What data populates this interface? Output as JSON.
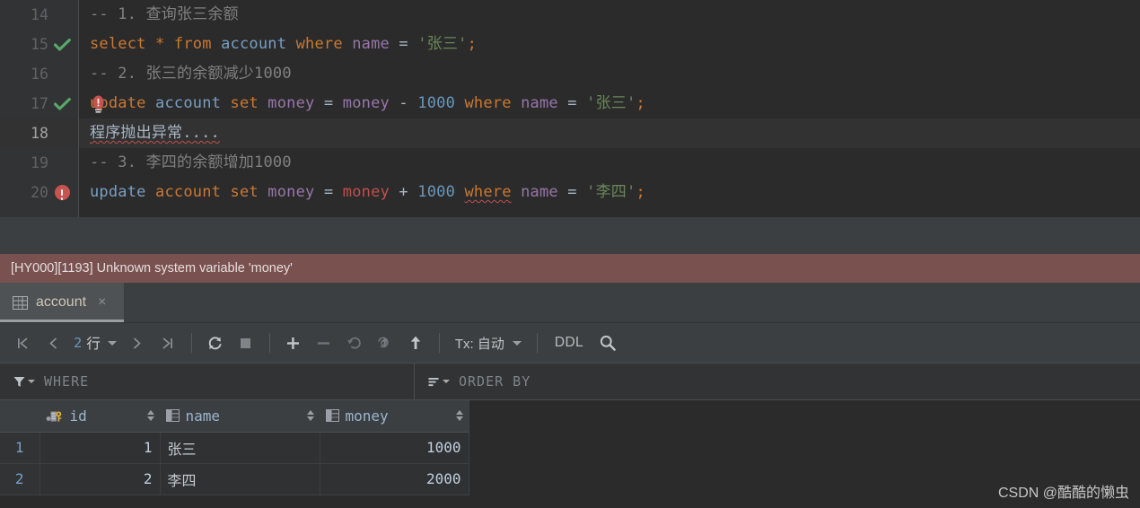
{
  "editor": {
    "lines": [
      {
        "number": "14",
        "marker": "none",
        "current": false,
        "tokens": [
          {
            "text": "-- 1. 查询张三余额",
            "cls": "cmt"
          }
        ]
      },
      {
        "number": "15",
        "marker": "check",
        "current": false,
        "tokens": [
          {
            "text": "select",
            "cls": "kw"
          },
          {
            "text": " ",
            "cls": "op"
          },
          {
            "text": "*",
            "cls": "kw"
          },
          {
            "text": " ",
            "cls": "op"
          },
          {
            "text": "from",
            "cls": "kw"
          },
          {
            "text": " ",
            "cls": "op"
          },
          {
            "text": "account",
            "cls": "tbl"
          },
          {
            "text": " ",
            "cls": "op"
          },
          {
            "text": "where",
            "cls": "kw"
          },
          {
            "text": " ",
            "cls": "op"
          },
          {
            "text": "name",
            "cls": "col"
          },
          {
            "text": " ",
            "cls": "op"
          },
          {
            "text": "=",
            "cls": "op"
          },
          {
            "text": " ",
            "cls": "op"
          },
          {
            "text": "'张三'",
            "cls": "str"
          },
          {
            "text": ";",
            "cls": "punct"
          }
        ]
      },
      {
        "number": "16",
        "marker": "none",
        "current": false,
        "tokens": [
          {
            "text": "-- 2. 张三的余额减少1000",
            "cls": "cmt"
          }
        ]
      },
      {
        "number": "17",
        "marker": "check",
        "current": false,
        "tokens": [
          {
            "text": "update",
            "cls": "kw"
          },
          {
            "text": " ",
            "cls": "op"
          },
          {
            "text": "account",
            "cls": "tbl"
          },
          {
            "text": " ",
            "cls": "op"
          },
          {
            "text": "set",
            "cls": "kw"
          },
          {
            "text": " ",
            "cls": "op"
          },
          {
            "text": "money",
            "cls": "col"
          },
          {
            "text": " ",
            "cls": "op"
          },
          {
            "text": "=",
            "cls": "op"
          },
          {
            "text": " ",
            "cls": "op"
          },
          {
            "text": "money",
            "cls": "col"
          },
          {
            "text": " ",
            "cls": "op"
          },
          {
            "text": "-",
            "cls": "op"
          },
          {
            "text": " ",
            "cls": "op"
          },
          {
            "text": "1000",
            "cls": "num"
          },
          {
            "text": " ",
            "cls": "op"
          },
          {
            "text": "where",
            "cls": "kw"
          },
          {
            "text": " ",
            "cls": "op"
          },
          {
            "text": "name",
            "cls": "col"
          },
          {
            "text": " ",
            "cls": "op"
          },
          {
            "text": "=",
            "cls": "op"
          },
          {
            "text": " ",
            "cls": "op"
          },
          {
            "text": "'张三'",
            "cls": "str"
          },
          {
            "text": ";",
            "cls": "punct"
          }
        ]
      },
      {
        "number": "18",
        "marker": "none",
        "current": true,
        "tokens": [
          {
            "text": "程序抛出异常....",
            "cls": "plaintxt squig"
          }
        ]
      },
      {
        "number": "19",
        "marker": "none",
        "current": false,
        "tokens": [
          {
            "text": "-- 3. 李四的余额增加1000",
            "cls": "cmt"
          }
        ]
      },
      {
        "number": "20",
        "marker": "error",
        "current": false,
        "tokens": [
          {
            "text": "update",
            "cls": "tbl"
          },
          {
            "text": " ",
            "cls": "op"
          },
          {
            "text": "account",
            "cls": "kw"
          },
          {
            "text": " ",
            "cls": "op"
          },
          {
            "text": "set",
            "cls": "kw"
          },
          {
            "text": " ",
            "cls": "op"
          },
          {
            "text": "money",
            "cls": "col"
          },
          {
            "text": " ",
            "cls": "op"
          },
          {
            "text": "=",
            "cls": "op"
          },
          {
            "text": " ",
            "cls": "op"
          },
          {
            "text": "money",
            "cls": "bad"
          },
          {
            "text": " ",
            "cls": "op"
          },
          {
            "text": "+",
            "cls": "op"
          },
          {
            "text": " ",
            "cls": "op"
          },
          {
            "text": "1000",
            "cls": "num"
          },
          {
            "text": " ",
            "cls": "op"
          },
          {
            "text": "where",
            "cls": "kw squig"
          },
          {
            "text": " ",
            "cls": "op"
          },
          {
            "text": "name",
            "cls": "col"
          },
          {
            "text": " ",
            "cls": "op"
          },
          {
            "text": "=",
            "cls": "op"
          },
          {
            "text": " ",
            "cls": "op"
          },
          {
            "text": "'李四'",
            "cls": "str"
          },
          {
            "text": ";",
            "cls": "punct"
          }
        ]
      }
    ],
    "intention_icon": "lightbulb-error-icon"
  },
  "error_bar": {
    "message": "[HY000][1193] Unknown system variable 'money'",
    "background_color": "#79514f"
  },
  "result_tab": {
    "icon": "table-grid-icon",
    "label": "account",
    "close_label": "×"
  },
  "toolbar": {
    "first_page_icon": "|<",
    "prev_page_icon": "‹",
    "rows_count": "2",
    "rows_unit": "行",
    "next_page_icon": "›",
    "last_page_icon": ">|",
    "reload_icon": "refresh-icon",
    "stop_icon": "stop-icon",
    "add_row_icon": "+",
    "remove_row_icon": "−",
    "revert_icon": "↶",
    "revert_selected_icon": "revert-selected-icon",
    "submit_icon": "↑",
    "tx_label": "Tx: 自动",
    "ddl_label": "DDL",
    "search_icon": "search-icon"
  },
  "filter_bar": {
    "where_icon": "filter-funnel-icon",
    "where_label": "WHERE",
    "order_icon": "sort-lines-icon",
    "order_label": "ORDER BY"
  },
  "grid": {
    "columns": [
      {
        "name": "id",
        "icon": "primary-key-icon",
        "align": "right"
      },
      {
        "name": "name",
        "icon": "column-icon",
        "align": "left"
      },
      {
        "name": "money",
        "icon": "column-icon",
        "align": "right"
      }
    ],
    "rows": [
      {
        "rownum": "1",
        "id": "1",
        "name": "张三",
        "money": "1000"
      },
      {
        "rownum": "2",
        "id": "2",
        "name": "李四",
        "money": "2000"
      }
    ]
  },
  "watermark": {
    "text": "CSDN @酷酷的懒虫"
  }
}
